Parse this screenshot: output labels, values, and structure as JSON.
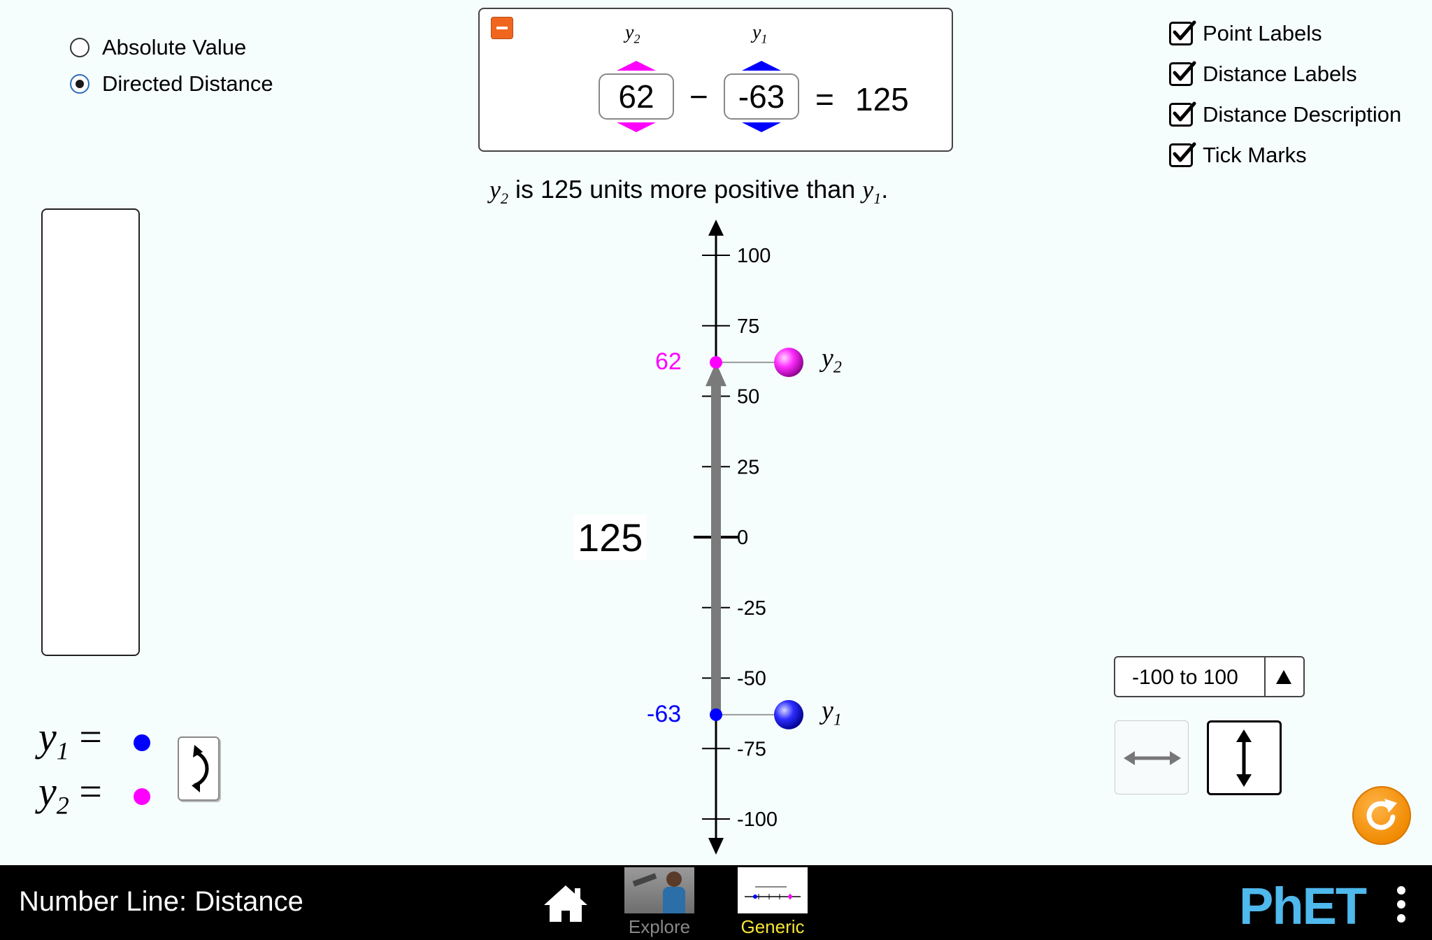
{
  "distance_type": {
    "options": [
      {
        "label": "Absolute Value",
        "selected": false
      },
      {
        "label": "Directed Distance",
        "selected": true
      }
    ]
  },
  "equation": {
    "y2_label": "y2",
    "y1_label": "y1",
    "y2_value": "62",
    "y1_value": "-63",
    "minus": "−",
    "equals": "=",
    "result": "125",
    "y2_color": "#ff00ff",
    "y1_color": "#0000ff"
  },
  "description": {
    "var_a": "y",
    "sub_a": "2",
    "text": "is 125 units more positive than",
    "var_b": "y",
    "sub_b": "1",
    "end": "."
  },
  "checkboxes": [
    {
      "label": "Point Labels",
      "checked": true
    },
    {
      "label": "Distance Labels",
      "checked": true
    },
    {
      "label": "Distance Description",
      "checked": true
    },
    {
      "label": "Tick Marks",
      "checked": true
    }
  ],
  "number_line": {
    "orientation": "vertical",
    "range": [
      -100,
      100
    ],
    "tick_labels": [
      "100",
      "75",
      "50",
      "25",
      "0",
      "-25",
      "-50",
      "-75",
      "-100"
    ],
    "distance_label": "125",
    "points": [
      {
        "name": "y2",
        "value": 62,
        "label": "62",
        "color": "#ff00ff"
      },
      {
        "name": "y1",
        "value": -63,
        "label": "-63",
        "color": "#0000ff"
      }
    ]
  },
  "point_controllers": {
    "y1_eq": "y",
    "y1_sub": "1",
    "y2_eq": "y",
    "y2_sub": "2",
    "equals": "="
  },
  "range_select": {
    "value": "-100 to 100"
  },
  "orientation": {
    "horizontal_icon": "horizontal-arrow-icon",
    "vertical_icon": "vertical-arrow-icon",
    "selected": "vertical"
  },
  "navbar": {
    "title": "Number Line: Distance",
    "screens": [
      {
        "label": "Explore",
        "selected": false
      },
      {
        "label": "Generic",
        "selected": true
      }
    ],
    "brand": "PhET",
    "accent": "#f7e634"
  }
}
